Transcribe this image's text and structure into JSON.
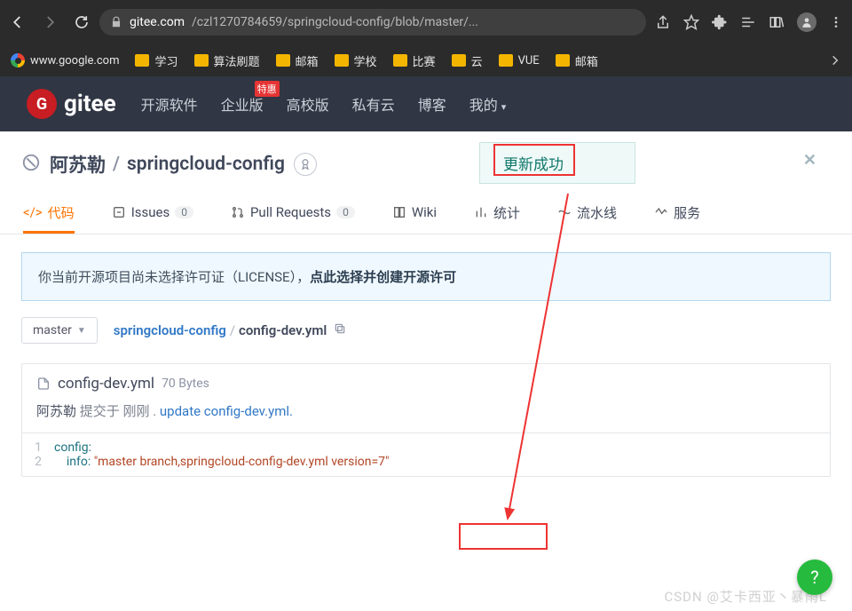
{
  "browser": {
    "url_host": "gitee.com",
    "url_path": "/czl1270784659/springcloud-config/blob/master/..."
  },
  "bookmarks": {
    "google": "www.google.com",
    "items": [
      "学习",
      "算法刷题",
      "邮箱",
      "学校",
      "比赛",
      "云",
      "VUE",
      "邮箱"
    ]
  },
  "gitee_nav": {
    "brand": "gitee",
    "items": [
      "开源软件",
      "企业版",
      "高校版",
      "私有云",
      "博客",
      "我的"
    ],
    "enterprise_badge": "特惠"
  },
  "repo": {
    "owner": "阿苏勒",
    "name": "springcloud-config",
    "notif": "更新成功"
  },
  "tabs": {
    "code": "代码",
    "issues": "Issues",
    "issues_count": "0",
    "pr": "Pull Requests",
    "pr_count": "0",
    "wiki": "Wiki",
    "stats": "统计",
    "pipeline": "流水线",
    "service": "服务"
  },
  "license": {
    "pre": "你当前开源项目尚未选择许可证（LICENSE），",
    "action": "点此选择并创建开源许可"
  },
  "branch": {
    "current": "master",
    "repo_link": "springcloud-config",
    "file": "config-dev.yml"
  },
  "file": {
    "name": "config-dev.yml",
    "size": "70 Bytes",
    "commit_author": "阿苏勒",
    "commit_when": "提交于 刚刚 .",
    "commit_msg": "update config-dev.yml.",
    "code": {
      "l1_key": "config:",
      "l2_key": "info:",
      "l2_val": "\"master branch,springcloud-config-dev.yml version=7\""
    }
  },
  "watermark": "CSDN @艾卡西亚丶暴雨L"
}
